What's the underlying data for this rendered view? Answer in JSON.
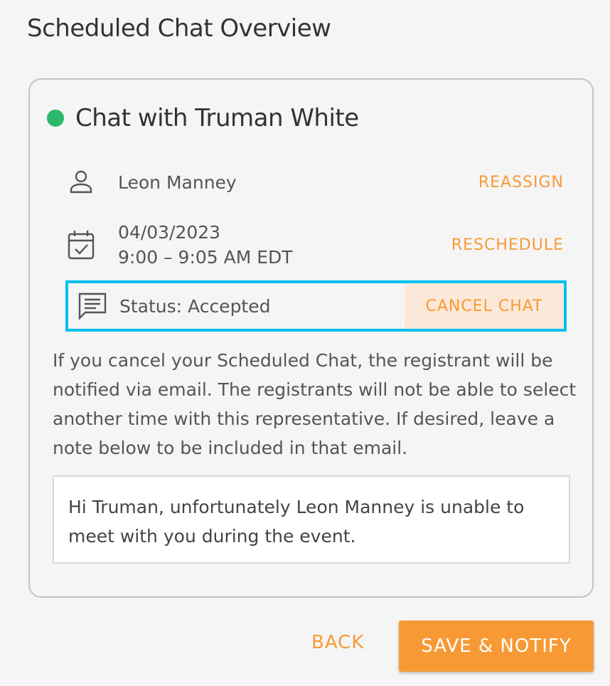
{
  "page": {
    "title": "Scheduled Chat Overview"
  },
  "chat": {
    "title": "Chat with Truman White",
    "status_color": "#2ab96a",
    "assignee": {
      "name": "Leon Manney",
      "icon": "person-icon",
      "action_label": "REASSIGN"
    },
    "schedule": {
      "date": "04/03/2023",
      "time": "9:00 – 9:05 AM EDT",
      "icon": "calendar-check-icon",
      "action_label": "RESCHEDULE"
    },
    "status": {
      "text": "Status: Accepted",
      "icon": "message-icon",
      "action_label": "CANCEL CHAT"
    },
    "cancel_info": "If you cancel your Scheduled Chat, the registrant will be notified via email. The registrants will not be able to select another time with this representative. If desired, leave a note below to be included in that email.",
    "note_value": "Hi Truman, unfortunately Leon Manney is unable to meet with you during the event."
  },
  "footer": {
    "back_label": "BACK",
    "save_label": "SAVE & NOTIFY"
  },
  "colors": {
    "accent": "#f79a35",
    "highlight": "#00bff0",
    "cancel_bg": "#fce8d8"
  }
}
